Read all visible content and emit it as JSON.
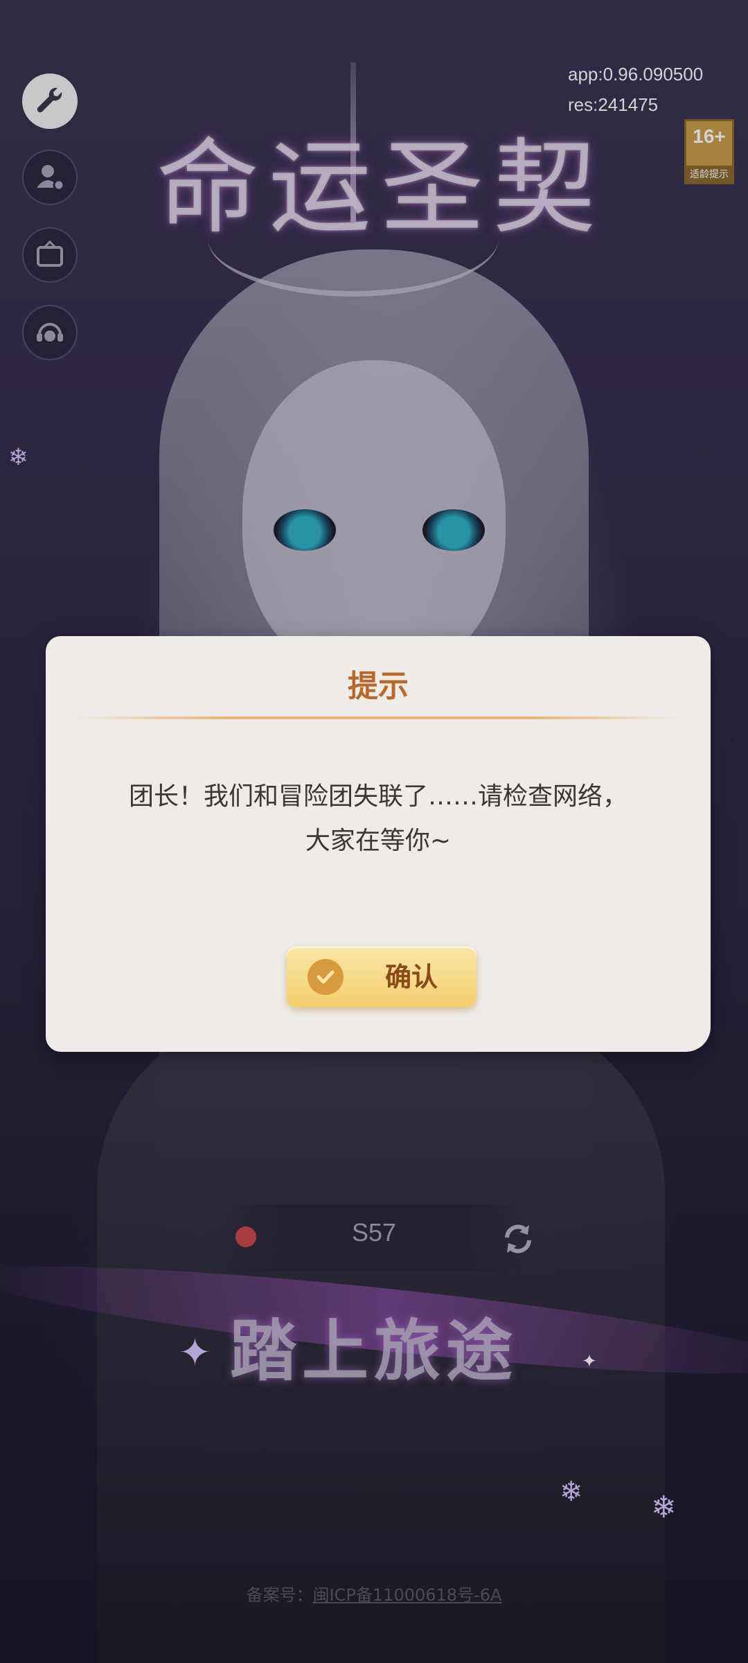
{
  "header": {
    "app_version": "app:0.96.090500",
    "res_version": "res:241475",
    "age_rating": "16+",
    "age_label": "适龄提示",
    "game_logo": "命运圣契"
  },
  "side_icons": [
    {
      "name": "settings-wrench-icon"
    },
    {
      "name": "account-icon"
    },
    {
      "name": "announcement-icon"
    },
    {
      "name": "customer-service-icon"
    }
  ],
  "server": {
    "name": "S57",
    "status_color": "#c84848"
  },
  "start_button": "踏上旅途",
  "icp": {
    "prefix": "备案号：",
    "number": "闽ICP备11000618号-6A"
  },
  "dialog": {
    "title": "提示",
    "message": "团长！我们和冒险团失联了……请检查网络，大家在等你~",
    "confirm_label": "确认"
  },
  "colors": {
    "dialog_bg": "#efece7",
    "title": "#b86a2e",
    "button": "#f3cf6e"
  }
}
